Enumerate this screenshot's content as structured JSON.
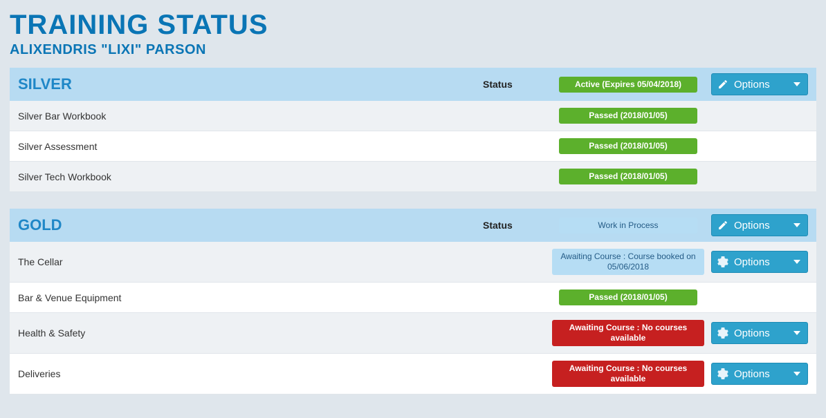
{
  "page_title": "TRAINING STATUS",
  "subtitle": "ALIXENDRIS \"LIXI\" PARSON",
  "status_label": "Status",
  "options_label": "Options",
  "sections": [
    {
      "name": "SILVER",
      "status_badge": {
        "text": "Active (Expires 05/04/2018)",
        "style": "green"
      },
      "header_options_icon": "pencil",
      "items": [
        {
          "name": "Silver Bar Workbook",
          "badge": {
            "text": "Passed (2018/01/05)",
            "style": "green"
          },
          "options": false
        },
        {
          "name": "Silver Assessment",
          "badge": {
            "text": "Passed (2018/01/05)",
            "style": "green"
          },
          "options": false
        },
        {
          "name": "Silver Tech Workbook",
          "badge": {
            "text": "Passed (2018/01/05)",
            "style": "green"
          },
          "options": false
        }
      ]
    },
    {
      "name": "GOLD",
      "status_badge": {
        "text": "Work in Process",
        "style": "blue"
      },
      "header_options_icon": "pencil",
      "items": [
        {
          "name": "The Cellar",
          "badge": {
            "text": "Awaiting Course : Course booked on 05/06/2018",
            "style": "blue"
          },
          "options": true,
          "options_icon": "gear"
        },
        {
          "name": "Bar & Venue Equipment",
          "badge": {
            "text": "Passed (2018/01/05)",
            "style": "green"
          },
          "options": false
        },
        {
          "name": "Health & Safety",
          "badge": {
            "text": "Awaiting Course : No courses available",
            "style": "red"
          },
          "options": true,
          "options_icon": "gear"
        },
        {
          "name": "Deliveries",
          "badge": {
            "text": "Awaiting Course : No courses available",
            "style": "red"
          },
          "options": true,
          "options_icon": "gear"
        }
      ]
    }
  ]
}
